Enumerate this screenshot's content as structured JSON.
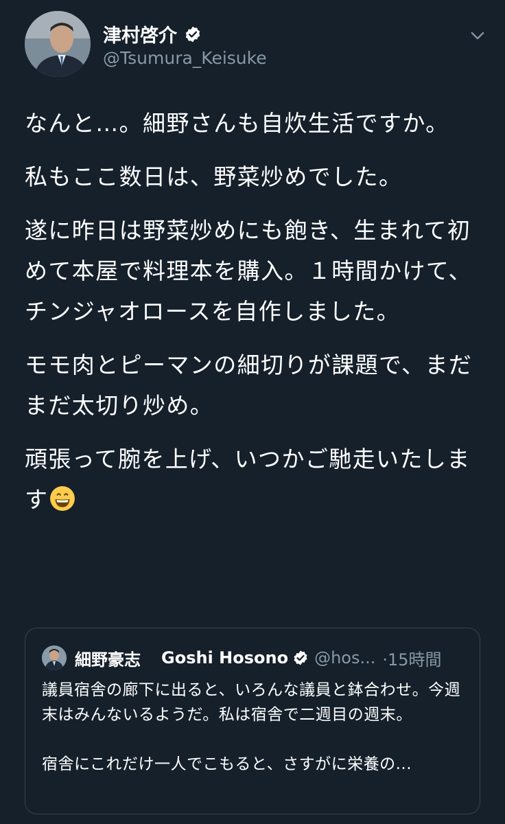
{
  "author": {
    "name": "津村啓介",
    "handle": "@Tsumura_Keisuke"
  },
  "tweet": {
    "paragraphs": [
      "なんと…。細野さんも自炊生活ですか。",
      "私もここ数日は、野菜炒めでした。",
      "遂に昨日は野菜炒めにも飽き、生まれて初めて本屋で料理本を購入。１時間かけて、チンジャオロースを自作しました。",
      "モモ肉とピーマンの細切りが課題で、まだまだ太切り炒め。",
      "頑張って腕を上げ、いつかご馳走いたします"
    ],
    "emoji": "grinning-face"
  },
  "quoted": {
    "name_jp": "細野豪志",
    "name_en": "Goshi Hosono",
    "handle": "@hos...",
    "time": "·15時間",
    "lines": [
      "議員宿舎の廊下に出ると、いろんな議員と鉢合わせ。今週末はみんないるようだ。私は宿舎で二週目の週末。",
      "宿舎にこれだけ一人でこもると、さすがに栄養の..."
    ]
  },
  "colors": {
    "background": "#15202b",
    "text": "#ffffff",
    "secondary": "#8899a6",
    "border": "#38444d"
  }
}
